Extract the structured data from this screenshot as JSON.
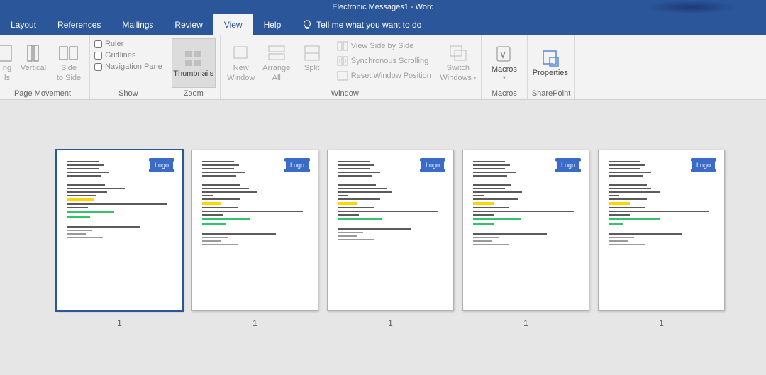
{
  "title": "Electronic Messages1  -  Word",
  "tabs": [
    "Layout",
    "References",
    "Mailings",
    "Review",
    "View",
    "Help"
  ],
  "active_tab": "View",
  "tellme": "Tell me what you want to do",
  "ribbon": {
    "page_movement": {
      "label": "Page Movement",
      "btn1_line1": "ng",
      "btn1_line2": "ls",
      "vertical": "Vertical",
      "side1": "Side",
      "side2": "to Side"
    },
    "show": {
      "label": "Show",
      "ruler": "Ruler",
      "gridlines": "Gridlines",
      "navpane": "Navigation Pane"
    },
    "zoom": {
      "label": "Zoom",
      "thumbnails": "Thumbnails"
    },
    "window1": {
      "new1": "New",
      "new2": "Window",
      "arr1": "Arrange",
      "arr2": "All",
      "split": "Split"
    },
    "window2": {
      "sbs": "View Side by Side",
      "sync": "Synchronous Scrolling",
      "reset": "Reset Window Position"
    },
    "window_group": "Window",
    "switch": {
      "l1": "Switch",
      "l2": "Windows"
    },
    "macros": {
      "label": "Macros",
      "btn": "Macros"
    },
    "sharepoint": {
      "label": "SharePoint",
      "btn": "Properties"
    }
  },
  "logo_text": "Logo",
  "page_number": "1"
}
